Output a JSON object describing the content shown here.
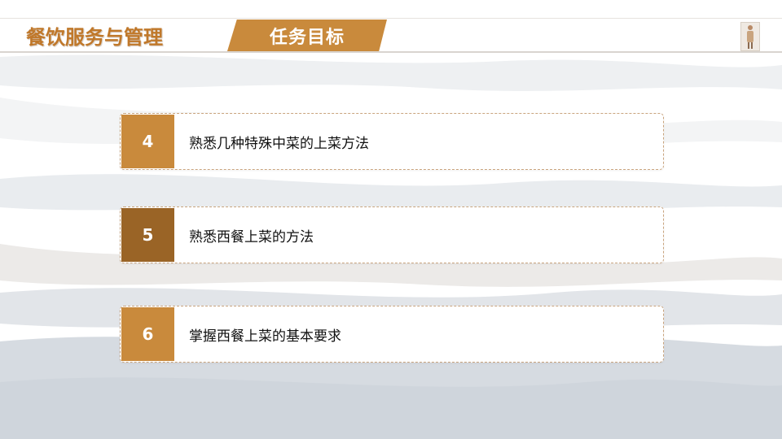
{
  "header": {
    "course_title": "餐饮服务与管理",
    "section_title": "任务目标"
  },
  "objectives": [
    {
      "number": "4",
      "text": "熟悉几种特殊中菜的上菜方法",
      "badge_color": "#c98a3c"
    },
    {
      "number": "5",
      "text": "熟悉西餐上菜的方法",
      "badge_color": "#9a6426"
    },
    {
      "number": "6",
      "text": "掌握西餐上菜的基本要求",
      "badge_color": "#c98a3c"
    }
  ],
  "colors": {
    "accent": "#c98a3c",
    "title": "#c0782a",
    "border": "#c9a47e"
  }
}
